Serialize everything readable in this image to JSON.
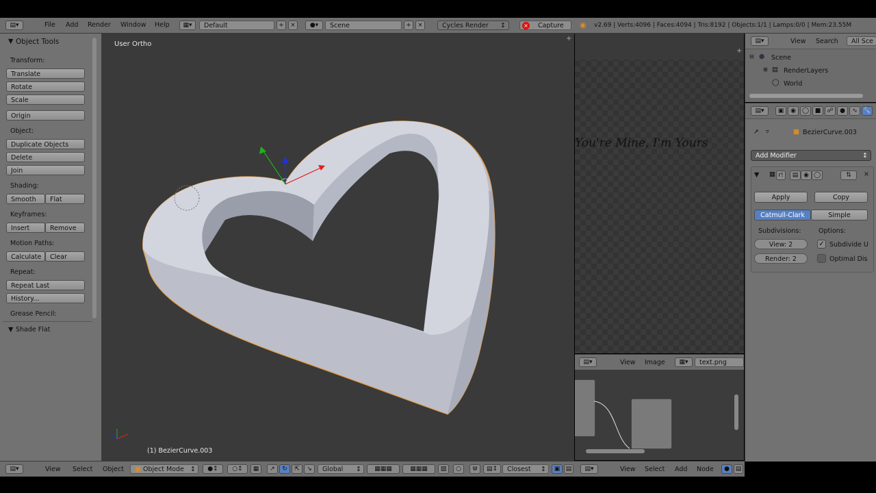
{
  "top_bar": {
    "menus": [
      "File",
      "Add",
      "Render",
      "Window",
      "Help"
    ],
    "screen_layout": "Default",
    "scene": "Scene",
    "render_engine": "Cycles Render",
    "capture_label": "Capture",
    "stats": "v2.69 | Verts:4096 | Faces:4094 | Tris:8192 | Objects:1/1 | Lamps:0/0 | Mem:23.55M"
  },
  "tool_shelf": {
    "panel_title": "Object Tools",
    "transform_label": "Transform:",
    "translate": "Translate",
    "rotate": "Rotate",
    "scale": "Scale",
    "origin": "Origin",
    "object_label": "Object:",
    "duplicate": "Duplicate Objects",
    "delete": "Delete",
    "join": "Join",
    "shading_label": "Shading:",
    "smooth": "Smooth",
    "flat": "Flat",
    "keyframes_label": "Keyframes:",
    "insert": "Insert",
    "remove": "Remove",
    "motion_paths_label": "Motion Paths:",
    "calculate": "Calculate",
    "clear": "Clear",
    "repeat_label": "Repeat:",
    "repeat_last": "Repeat Last",
    "history": "History...",
    "grease_pencil_label": "Grease Pencil:",
    "shade_flat_panel": "Shade Flat"
  },
  "viewport": {
    "view_name": "User Ortho",
    "object_info": "(1) BezierCurve.003",
    "colors": {
      "background": "#393939",
      "mesh": "#c9ccd6",
      "selection_outline": "#e79a3c"
    }
  },
  "bottom_bar": {
    "view": "View",
    "select": "Select",
    "object": "Object",
    "mode": "Object Mode",
    "orientation": "Global",
    "snap_target": "Closest"
  },
  "image_editor": {
    "overlay_text": "You're Mine, I'm Yours"
  },
  "node_editor": {
    "header_view": "View",
    "header_image": "Image",
    "image_name": "text.png",
    "footer_view": "View",
    "footer_select": "Select",
    "footer_add": "Add",
    "footer_node": "Node"
  },
  "outliner": {
    "search": "Search",
    "view": "View",
    "filter": "All Sce",
    "items": [
      {
        "label": "Scene",
        "level": 0
      },
      {
        "label": "RenderLayers",
        "level": 1
      },
      {
        "label": "World",
        "level": 1
      }
    ]
  },
  "properties": {
    "object_name": "BezierCurve.003",
    "add_modifier": "Add Modifier",
    "apply": "Apply",
    "copy": "Copy",
    "subdiv_type_active": "Catmull-Clark",
    "subdiv_type_other": "Simple",
    "subdivisions_label": "Subdivisions:",
    "options_label": "Options:",
    "view_levels": "View: 2",
    "render_levels": "Render: 2",
    "subdivide_uvs": "Subdivide U",
    "optimal_display": "Optimal Dis"
  }
}
